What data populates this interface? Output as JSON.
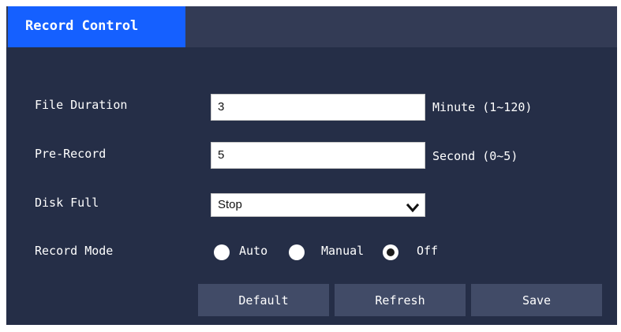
{
  "tabs": {
    "active_label": "Record Control"
  },
  "form": {
    "file_duration": {
      "label": "File Duration",
      "value": "3",
      "unit": "Minute (1~120)"
    },
    "pre_record": {
      "label": "Pre-Record",
      "value": "5",
      "unit": "Second (0~5)"
    },
    "disk_full": {
      "label": "Disk Full",
      "selected": "Stop"
    },
    "record_mode": {
      "label": "Record Mode",
      "options": [
        "Auto",
        "Manual",
        "Off"
      ],
      "selected": "Off"
    }
  },
  "buttons": {
    "default": "Default",
    "refresh": "Refresh",
    "save": "Save"
  },
  "colors": {
    "panel": "#252e47",
    "header": "#333b55",
    "accent": "#1560ff",
    "button": "#414b67"
  },
  "icons": {
    "dropdown": "chevron-down-icon"
  }
}
